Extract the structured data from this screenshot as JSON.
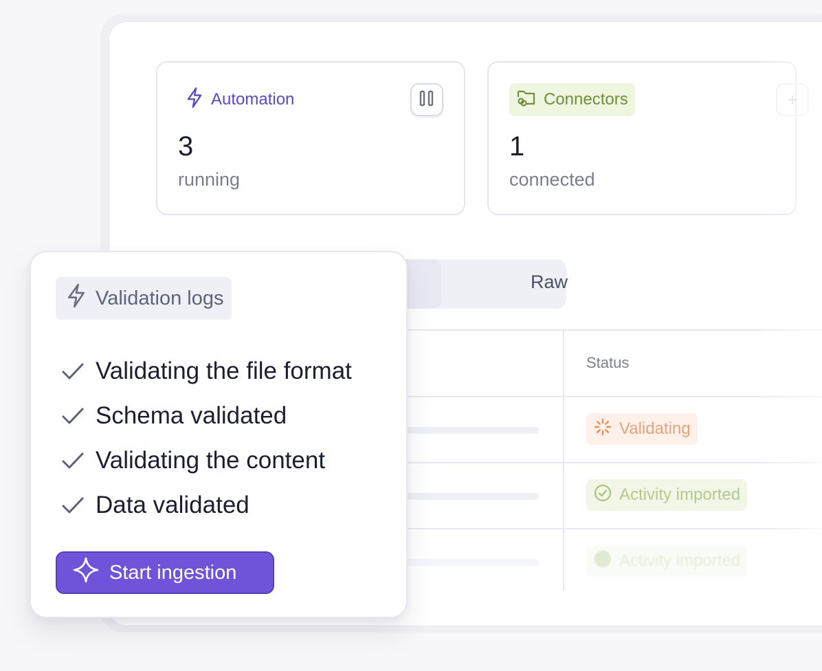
{
  "automation_card": {
    "title": "Automation",
    "count": "3",
    "label": "running",
    "icon": "lightning-icon"
  },
  "connectors_card": {
    "title": "Connectors",
    "count": "1",
    "label": "connected",
    "icon": "folder-link-icon"
  },
  "view_toggle": {
    "raw_label": "Raw"
  },
  "table": {
    "status_header": "Status",
    "rows": [
      {
        "status": "Validating"
      },
      {
        "status": "Activity imported"
      },
      {
        "status": "Activity imported"
      }
    ]
  },
  "validation_logs": {
    "title": "Validation logs",
    "items": [
      "Validating the file format",
      "Schema validated",
      "Validating the content",
      "Data validated"
    ],
    "action_label": "Start ingestion"
  },
  "colors": {
    "accent": "#6f54d9",
    "automation": "#5b48c4",
    "connectors": "#6f8f3a",
    "validating": "#e7a47d",
    "imported": "#b5c98f"
  }
}
